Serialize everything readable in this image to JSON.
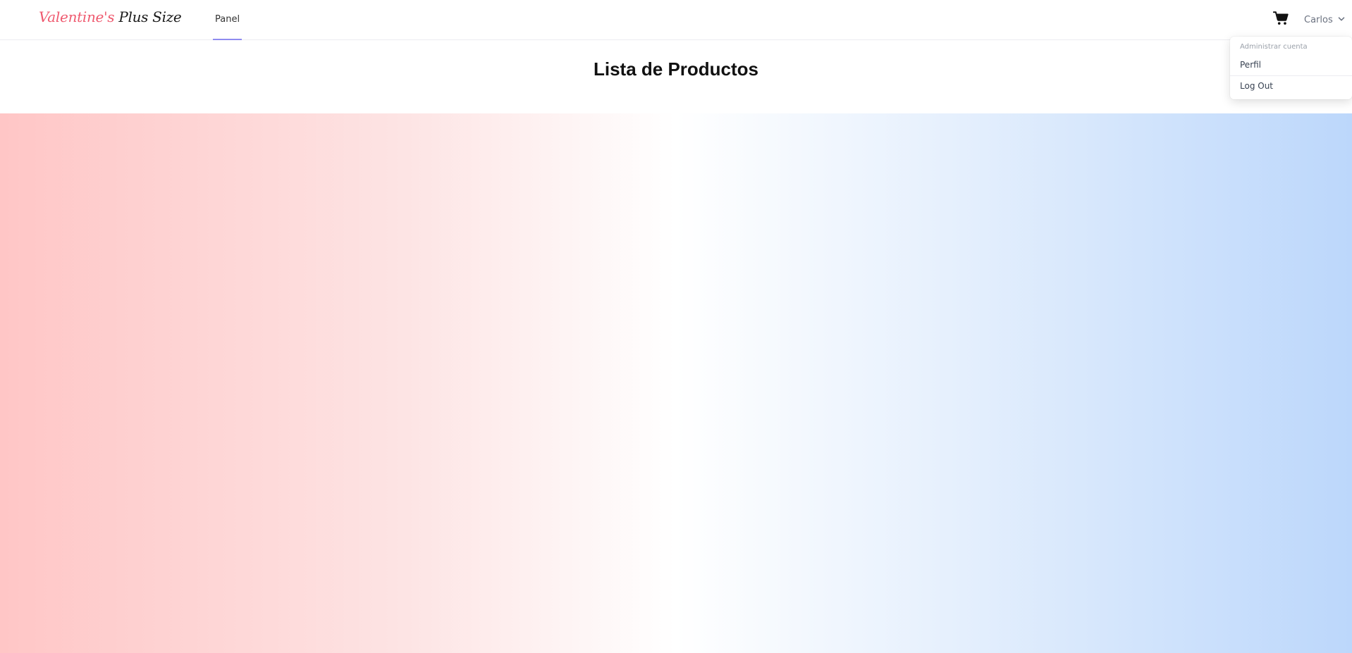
{
  "brand": {
    "part1": "Valentine's",
    "part2": "Plus Size",
    "accent_color": "#ef5a6f"
  },
  "nav": {
    "links": [
      {
        "label": "Panel",
        "active": true
      }
    ],
    "active_underline_color": "#8f8bf0"
  },
  "header_right": {
    "cart_icon": "shopping-cart-icon",
    "user_name": "Carlos",
    "user_menu_icon": "chevron-down-icon"
  },
  "dropdown": {
    "heading": "Administrar cuenta",
    "items": [
      {
        "label": "Perfil"
      },
      {
        "label": "Log Out"
      }
    ]
  },
  "page": {
    "title": "Lista de Productos"
  },
  "background": {
    "gradient_left": "#ffc6c6",
    "gradient_right": "#bcd7fb"
  }
}
